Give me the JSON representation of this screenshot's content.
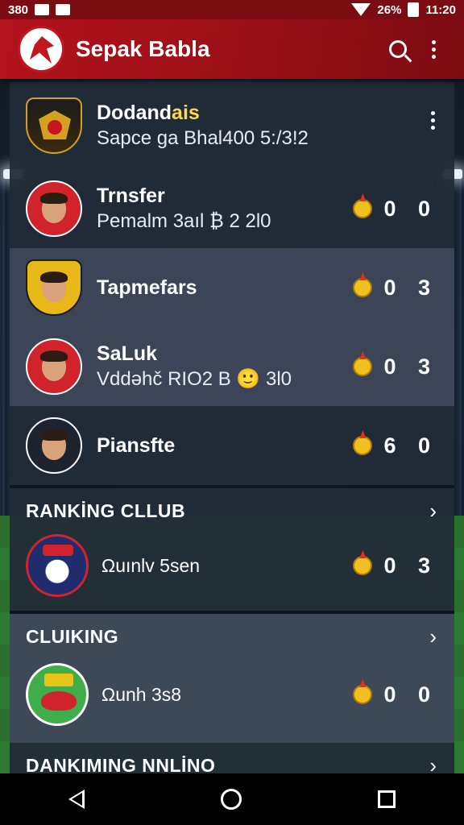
{
  "status_bar": {
    "left_text": "380",
    "battery": "26%",
    "time": "11:20"
  },
  "app_bar": {
    "title": "Sepak Babla"
  },
  "rows": [
    {
      "title": "Dodand",
      "title_highlight": "ais",
      "subtitle": "Sapce ga Bhal400 5:/3!2",
      "score": "",
      "style": "dark",
      "has_menu": true
    },
    {
      "title": "Trnsfer",
      "subtitle": "Pemalm 3aıl ₿ 2 2l0",
      "score": "0 0",
      "style": "dark"
    },
    {
      "title": "Tapmefars",
      "subtitle": "",
      "score": "0 3",
      "style": "light"
    },
    {
      "title": "SaLuk",
      "subtitle": "Vddəhč RIO2 B 🙂 3l0",
      "score": "0 3",
      "style": "light"
    },
    {
      "title": "Piansfte",
      "subtitle": "",
      "score": "6 0",
      "style": "dark"
    }
  ],
  "sections": [
    {
      "title": "RANKİNG CLLUB",
      "count_text": "Ωuınlv 5sen",
      "score": "0 3"
    },
    {
      "title": "CLUIKING",
      "count_text": "Ωunh 3s8",
      "score": "0 0"
    },
    {
      "title": "DANKIMING NNLİNO",
      "count_text": "",
      "score": ""
    }
  ],
  "colors": {
    "accent": "#b3131c",
    "row_dark": "#222b38",
    "row_light": "#3e4758",
    "medal": "#f0c020"
  },
  "icons": [
    "search-icon",
    "more-vert-icon",
    "medal-icon",
    "chevron-right-icon",
    "back-icon",
    "home-icon",
    "recents-icon"
  ]
}
